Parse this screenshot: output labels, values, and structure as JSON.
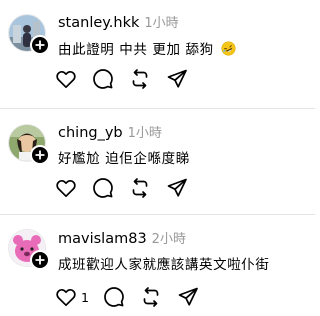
{
  "posts": [
    {
      "username": "stanley.hkk",
      "time": "1小時",
      "text": "由此證明 中共 更加 舔狗",
      "emoji": "rolling-on-floor-laughing-emoji",
      "like_count": ""
    },
    {
      "username": "ching_yb",
      "time": "1小時",
      "text": "好尷尬 迫佢企喺度睇",
      "like_count": ""
    },
    {
      "username": "mavislam83",
      "time": "2小時",
      "text": "成班歡迎人家就應該講英文啦仆街",
      "like_count": "1"
    }
  ],
  "icons": {
    "like": "heart-icon",
    "reply": "speech-bubble-icon",
    "repost": "repost-icon",
    "share": "send-icon",
    "follow": "plus-icon"
  },
  "colors": {
    "text": "#000000",
    "meta": "#999999",
    "divider": "#e5e5e5",
    "emoji": "#f5c518",
    "avatar3": "#e86bb8"
  }
}
